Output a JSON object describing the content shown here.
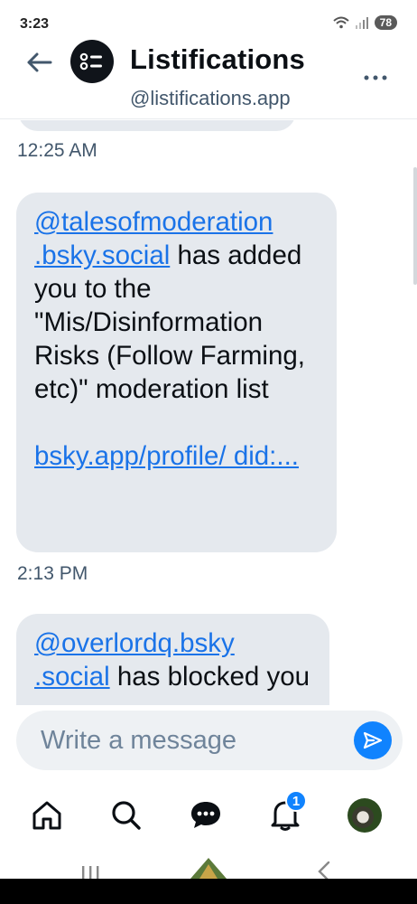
{
  "status_bar": {
    "time": "3:23",
    "battery": "78"
  },
  "header": {
    "title": "Listifications",
    "handle": "@listifications.app"
  },
  "messages": [
    {
      "timestamp": "12:25 AM",
      "mention": "@talesofmoderation .bsky.social",
      "body": " has added you to the \"Mis/Disinformation Risks (Follow Farming, etc)\" moderation list",
      "link": "bsky.app/profile/ did:..."
    },
    {
      "timestamp": "2:13 PM",
      "mention": "@overlordq.bsky .social",
      "body": " has blocked you"
    }
  ],
  "composer": {
    "placeholder": "Write a message"
  },
  "nav": {
    "notification_badge": "1"
  },
  "colors": {
    "accent": "#1083fe",
    "link": "#1a73e8",
    "bubble": "#e5e9ee"
  }
}
